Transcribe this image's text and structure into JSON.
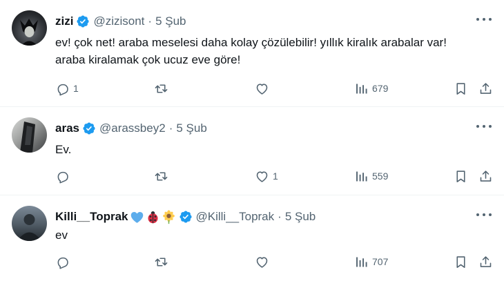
{
  "tweets": [
    {
      "name": "zizi",
      "handle": "@zizisont",
      "separator": "·",
      "date": "5 Şub",
      "text_lines": [
        "ev! çok net! araba meselesi daha kolay çözülebilir! yıllık kiralık arabalar var!",
        "araba kiralamak çok ucuz eve göre!"
      ],
      "replies": "1",
      "retweets": "",
      "likes": "",
      "views": "679",
      "emojis": []
    },
    {
      "name": "aras",
      "handle": "@arassbey2",
      "separator": "·",
      "date": "5 Şub",
      "text_lines": [
        "Ev."
      ],
      "replies": "",
      "retweets": "",
      "likes": "1",
      "views": "559",
      "emojis": []
    },
    {
      "name": "Killi__Toprak",
      "handle": "@Killi__Toprak",
      "separator": "·",
      "date": "5 Şub",
      "text_lines": [
        "ev"
      ],
      "replies": "",
      "retweets": "",
      "likes": "",
      "views": "707",
      "emojis": [
        "blue-heart",
        "ladybug",
        "sunflower"
      ]
    }
  ],
  "colors": {
    "text": "#0f1419",
    "secondary": "#536471",
    "verified": "#1d9bf0",
    "divider": "#eff3f4"
  },
  "icons": {
    "reply": "reply-icon",
    "retweet": "retweet-icon",
    "like": "like-icon",
    "views": "views-icon",
    "bookmark": "bookmark-icon",
    "share": "share-icon",
    "more": "more-icon",
    "verified": "verified-badge-icon"
  }
}
